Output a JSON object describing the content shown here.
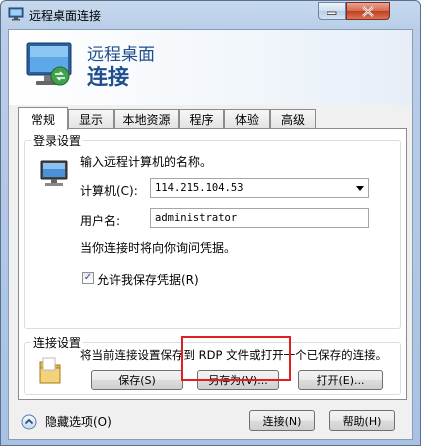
{
  "window": {
    "title": "远程桌面连接",
    "icon": "remote-desktop-icon"
  },
  "banner": {
    "line1": "远程桌面",
    "line2": "连接"
  },
  "tabs": [
    {
      "label": "常规",
      "active": true
    },
    {
      "label": "显示",
      "active": false
    },
    {
      "label": "本地资源",
      "active": false
    },
    {
      "label": "程序",
      "active": false
    },
    {
      "label": "体验",
      "active": false
    },
    {
      "label": "高级",
      "active": false
    }
  ],
  "login": {
    "group_title": "登录设置",
    "prompt": "输入远程计算机的名称。",
    "computer_label": "计算机(C):",
    "computer_value": "114.215.104.53",
    "username_label": "用户名:",
    "username_value": "administrator",
    "credentials_note": "当你连接时将向你询问凭据。",
    "allow_save_label": "允许我保存凭据(R)",
    "allow_save_checked": true
  },
  "connection": {
    "group_title": "连接设置",
    "description": "将当前连接设置保存到 RDP 文件或打开一个已保存的连接。",
    "save_label": "保存(S)",
    "save_as_label": "另存为(V)...",
    "open_label": "打开(E)..."
  },
  "footer": {
    "hide_options_label": "隐藏选项(O)",
    "connect_label": "连接(N)",
    "help_label": "帮助(H)"
  },
  "colors": {
    "accent": "#1f4e8c",
    "highlight_box": "#e02020"
  }
}
